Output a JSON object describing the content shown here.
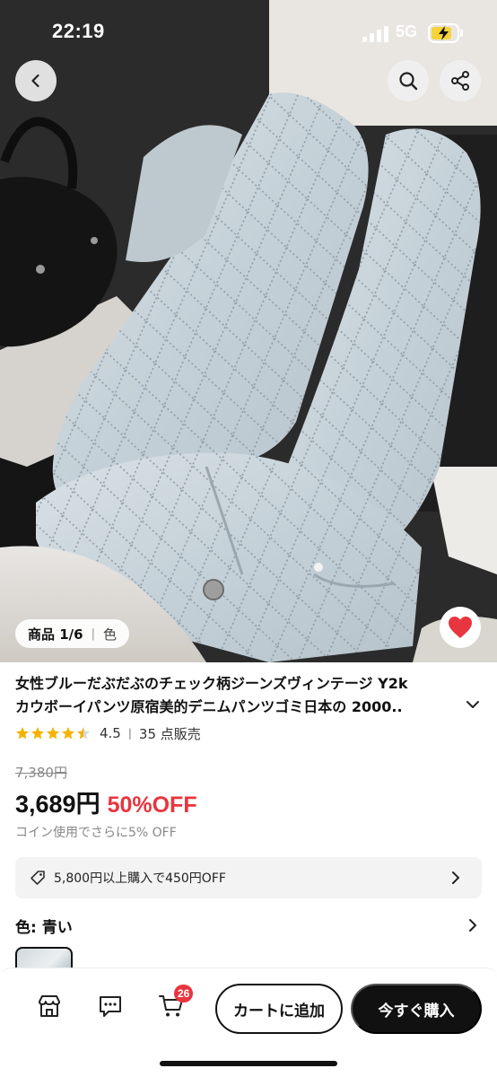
{
  "status_bar": {
    "time": "22:19",
    "network": "5G"
  },
  "gallery": {
    "counter": "商品 1/6",
    "color_tab": "色"
  },
  "product": {
    "title_line1": "女性ブルーだぶだぶのチェック柄ジーンズヴィンテージ Y2k",
    "title_line2": "カウボーイパンツ原宿美的デニムパンツゴミ日本の 2000..",
    "rating": "4.5",
    "rating_stars": 4.5,
    "sold": "35 点販売",
    "original_price": "7,380円",
    "price": "3,689円",
    "discount": "50%OFF",
    "coin_note": "コイン使用でさらに5% OFF",
    "coupon_text": "5,800円以上購入で450円OFF",
    "color_label": "色: 青い"
  },
  "bottom_bar": {
    "cart_count": "26",
    "add_to_cart": "カートに追加",
    "buy_now": "今すぐ購入"
  },
  "colors": {
    "accent_red": "#e8353f",
    "star_gold": "#f5b301",
    "dark": "#111111"
  }
}
